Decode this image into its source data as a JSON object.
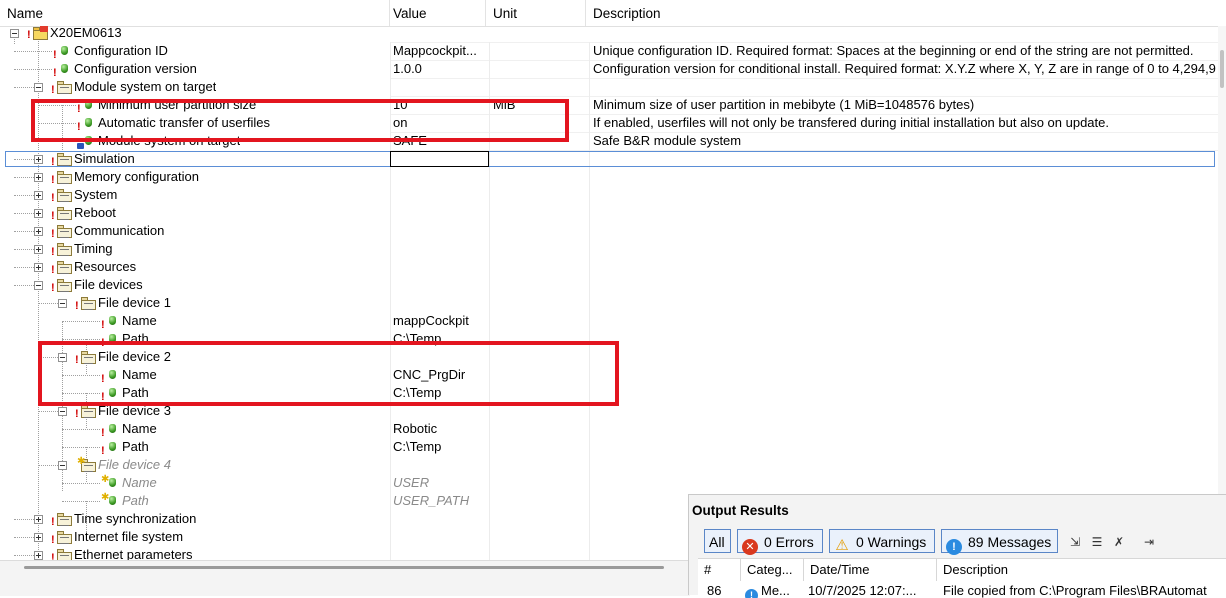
{
  "columns": {
    "name": "Name",
    "value": "Value",
    "unit": "Unit",
    "description": "Description"
  },
  "rows": [
    {
      "name": "X20EM0613",
      "value": "",
      "unit": "",
      "desc": ""
    },
    {
      "name": "Configuration ID",
      "value": "Mappcockpit...",
      "unit": "",
      "desc": "Unique configuration ID. Required format: Spaces at the beginning or end of the string are not permitted."
    },
    {
      "name": "Configuration version",
      "value": "1.0.0",
      "unit": "",
      "desc": "Configuration version for conditional install. Required format: X.Y.Z where X, Y, Z are in range of 0 to 4,294,9"
    },
    {
      "name": "Module system on target",
      "value": "",
      "unit": "",
      "desc": ""
    },
    {
      "name": "Minimum user partition size",
      "value": "10",
      "unit": "MiB",
      "desc": "Minimum size of user partition in mebibyte (1 MiB=1048576 bytes)"
    },
    {
      "name": "Automatic transfer of userfiles",
      "value": "on",
      "unit": "",
      "desc": "If enabled, userfiles will not only be transfered during initial installation but also on update."
    },
    {
      "name": "Module system on target",
      "value": "SAFE",
      "unit": "",
      "desc": "Safe B&R module system"
    },
    {
      "name": "Simulation",
      "value": "",
      "unit": "",
      "desc": ""
    },
    {
      "name": "Memory configuration",
      "value": "",
      "unit": "",
      "desc": ""
    },
    {
      "name": "System",
      "value": "",
      "unit": "",
      "desc": ""
    },
    {
      "name": "Reboot",
      "value": "",
      "unit": "",
      "desc": ""
    },
    {
      "name": "Communication",
      "value": "",
      "unit": "",
      "desc": ""
    },
    {
      "name": "Timing",
      "value": "",
      "unit": "",
      "desc": ""
    },
    {
      "name": "Resources",
      "value": "",
      "unit": "",
      "desc": ""
    },
    {
      "name": "File devices",
      "value": "",
      "unit": "",
      "desc": ""
    },
    {
      "name": "File device 1",
      "value": "",
      "unit": "",
      "desc": ""
    },
    {
      "name": "Name",
      "value": "mappCockpit",
      "unit": "",
      "desc": ""
    },
    {
      "name": "Path",
      "value": "C:\\Temp",
      "unit": "",
      "desc": ""
    },
    {
      "name": "File device 2",
      "value": "",
      "unit": "",
      "desc": ""
    },
    {
      "name": "Name",
      "value": "CNC_PrgDir",
      "unit": "",
      "desc": ""
    },
    {
      "name": "Path",
      "value": "C:\\Temp",
      "unit": "",
      "desc": ""
    },
    {
      "name": "File device 3",
      "value": "",
      "unit": "",
      "desc": ""
    },
    {
      "name": "Name",
      "value": "Robotic",
      "unit": "",
      "desc": ""
    },
    {
      "name": "Path",
      "value": "C:\\Temp",
      "unit": "",
      "desc": ""
    },
    {
      "name": "File device 4",
      "value": "",
      "unit": "",
      "desc": ""
    },
    {
      "name": "Name",
      "value": "USER",
      "unit": "",
      "desc": ""
    },
    {
      "name": "Path",
      "value": "USER_PATH",
      "unit": "",
      "desc": ""
    },
    {
      "name": "Time synchronization",
      "value": "",
      "unit": "",
      "desc": ""
    },
    {
      "name": "Internet file system",
      "value": "",
      "unit": "",
      "desc": ""
    },
    {
      "name": "Ethernet parameters",
      "value": "",
      "unit": "",
      "desc": ""
    }
  ],
  "output": {
    "title": "Output Results",
    "all_label": "All",
    "errors_label": "0 Errors",
    "warnings_label": "0 Warnings",
    "messages_label": "89 Messages",
    "table_headers": {
      "num": "#",
      "category": "Categ...",
      "datetime": "Date/Time",
      "description": "Description"
    },
    "first_row": {
      "num": "86",
      "category": "Me...",
      "datetime": "10/7/2025 12:07:...",
      "description": "File copied from C:\\Program Files\\BRAutomat"
    }
  },
  "colors": {
    "highlight_box": "#e3151f",
    "selection": "#5b8ed6"
  },
  "icons": [
    "folder-icon",
    "parameter-icon",
    "error-mark-icon",
    "new-item-icon",
    "lock-icon",
    "error-icon",
    "warning-icon",
    "info-icon"
  ]
}
